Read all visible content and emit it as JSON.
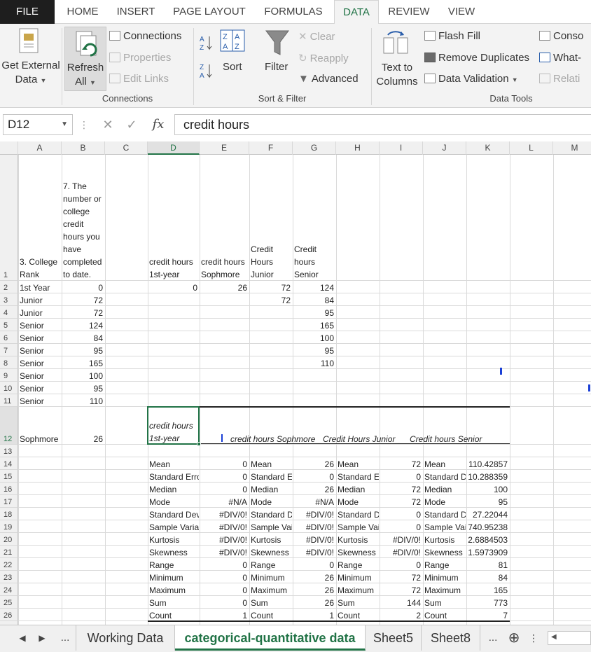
{
  "ribbon_tabs": [
    "FILE",
    "HOME",
    "INSERT",
    "PAGE LAYOUT",
    "FORMULAS",
    "DATA",
    "REVIEW",
    "VIEW"
  ],
  "ribbon": {
    "get_external": [
      "Get External",
      "Data"
    ],
    "refresh": [
      "Refresh",
      "All"
    ],
    "connections": "Connections",
    "properties": "Properties",
    "edit_links": "Edit Links",
    "group_connections": "Connections",
    "sort": "Sort",
    "filter": "Filter",
    "clear": "Clear",
    "reapply": "Reapply",
    "advanced": "Advanced",
    "group_sort_filter": "Sort & Filter",
    "text_to": [
      "Text to",
      "Columns"
    ],
    "flash_fill": "Flash Fill",
    "remove_duplicates": "Remove Duplicates",
    "data_validation": "Data Validation",
    "consolidate": "Conso",
    "what_if": "What-",
    "relationships": "Relati",
    "group_data_tools": "Data Tools"
  },
  "formula_bar": {
    "name_box": "D12",
    "formula": "credit hours"
  },
  "column_headers": [
    "A",
    "B",
    "C",
    "D",
    "E",
    "F",
    "G",
    "H",
    "I",
    "J",
    "K",
    "L",
    "M"
  ],
  "row_headers": [
    "1",
    "2",
    "3",
    "4",
    "5",
    "6",
    "7",
    "8",
    "9",
    "10",
    "11",
    "12",
    "13",
    "14",
    "15",
    "16",
    "17",
    "18",
    "19",
    "20",
    "21",
    "22",
    "23",
    "24",
    "25",
    "26",
    "27"
  ],
  "sheet": {
    "a1": [
      "3. College",
      "Rank"
    ],
    "b1": [
      "7. The",
      "number or",
      "college",
      "credit",
      "hours you",
      "have",
      "completed",
      "to date."
    ],
    "d1": [
      "credit hours",
      "1st-year"
    ],
    "e1": [
      "credit hours",
      "Sophmore"
    ],
    "f1": [
      "Credit",
      "Hours",
      "Junior"
    ],
    "g1": [
      "Credit",
      "hours",
      "Senior"
    ],
    "col_a": [
      "1st Year",
      "Junior",
      "Junior",
      "Senior",
      "Senior",
      "Senior",
      "Senior",
      "Senior",
      "Senior",
      "Senior"
    ],
    "col_b": [
      "0",
      "72",
      "72",
      "124",
      "84",
      "95",
      "165",
      "100",
      "95",
      "110"
    ],
    "d2": "0",
    "e2": "26",
    "col_f": [
      "72",
      "72"
    ],
    "col_g": [
      "124",
      "84",
      "95",
      "165",
      "100",
      "95",
      "110"
    ],
    "a12": "Sophmore",
    "b12": "26",
    "d12": [
      "credit hours",
      "1st-year"
    ],
    "e12": "credit hours Sophmore",
    "h12": "Credit Hours Junior",
    "j12": "Credit hours Senior",
    "stats_labels": [
      "Mean",
      "Standard Error",
      "Median",
      "Mode",
      "Standard Deviation",
      "Sample Variance",
      "Kurtosis",
      "Skewness",
      "Range",
      "Minimum",
      "Maximum",
      "Sum",
      "Count"
    ],
    "stats_labels_f": [
      "Mean",
      "Standard E",
      "Median",
      "Mode",
      "Standard D",
      "Sample Vai",
      "Kurtosis",
      "Skewness",
      "Range",
      "Minimum",
      "Maximum",
      "Sum",
      "Count"
    ],
    "stats_labels_h": [
      "Mean",
      "Standard E",
      "Median",
      "Mode",
      "Standard D",
      "Sample Vai",
      "Kurtosis",
      "Skewness",
      "Range",
      "Minimum",
      "Maximum",
      "Sum",
      "Count"
    ],
    "stats_labels_j": [
      "Mean",
      "Standard D",
      "Median",
      "Mode",
      "Standard D",
      "Sample Vai",
      "Kurtosis",
      "Skewness",
      "Range",
      "Minimum",
      "Maximum",
      "Sum",
      "Count"
    ],
    "stats_e": [
      "0",
      "0",
      "0",
      "#N/A",
      "#DIV/0!",
      "#DIV/0!",
      "#DIV/0!",
      "#DIV/0!",
      "0",
      "0",
      "0",
      "0",
      "1"
    ],
    "stats_g": [
      "26",
      "0",
      "26",
      "#N/A",
      "#DIV/0!",
      "#DIV/0!",
      "#DIV/0!",
      "#DIV/0!",
      "0",
      "26",
      "26",
      "26",
      "1"
    ],
    "stats_i": [
      "72",
      "0",
      "72",
      "72",
      "0",
      "0",
      "#DIV/0!",
      "#DIV/0!",
      "0",
      "72",
      "72",
      "144",
      "2"
    ],
    "stats_k": [
      "110.42857",
      "10.288359",
      "100",
      "95",
      "27.22044",
      "740.95238",
      "2.6884503",
      "1.5973909",
      "81",
      "84",
      "165",
      "773",
      "7"
    ]
  },
  "sheet_tabs": [
    "Working Data",
    "categorical-quantitative data",
    "Sheet5",
    "Sheet8"
  ],
  "sheet_nav": [
    "◀",
    "▶",
    "...",
    "...",
    "⊕",
    "⋮"
  ],
  "accent_color": "#217346"
}
